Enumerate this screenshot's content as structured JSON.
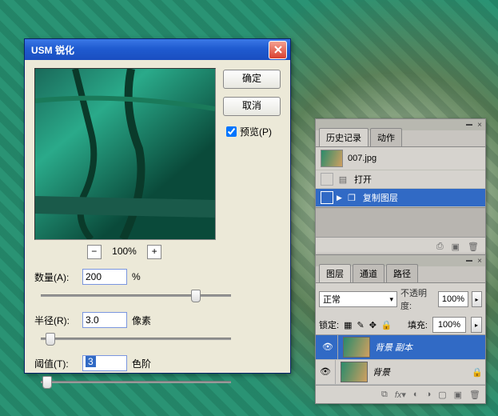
{
  "usm": {
    "title": "USM 锐化",
    "ok": "确定",
    "cancel": "取消",
    "preview_label": "预览(P)",
    "preview_checked": true,
    "zoom": "100%",
    "amount_label": "数量(A):",
    "amount_value": "200",
    "amount_unit": "%",
    "radius_label": "半径(R):",
    "radius_value": "3.0",
    "radius_unit": "像素",
    "threshold_label": "阈值(T):",
    "threshold_value": "3",
    "threshold_unit": "色阶"
  },
  "history": {
    "tabs": [
      "历史记录",
      "动作"
    ],
    "doc": "007.jpg",
    "items": [
      "打开",
      "复制图层"
    ],
    "selected": 1
  },
  "layers": {
    "tabs": [
      "图层",
      "通道",
      "路径"
    ],
    "blend": "正常",
    "opacity_label": "不透明度:",
    "opacity": "100%",
    "lock_label": "锁定:",
    "fill_label": "填充:",
    "fill": "100%",
    "rows": [
      {
        "name": "背景 副本",
        "locked": false,
        "selected": true
      },
      {
        "name": "背景",
        "locked": true,
        "selected": false
      }
    ]
  }
}
